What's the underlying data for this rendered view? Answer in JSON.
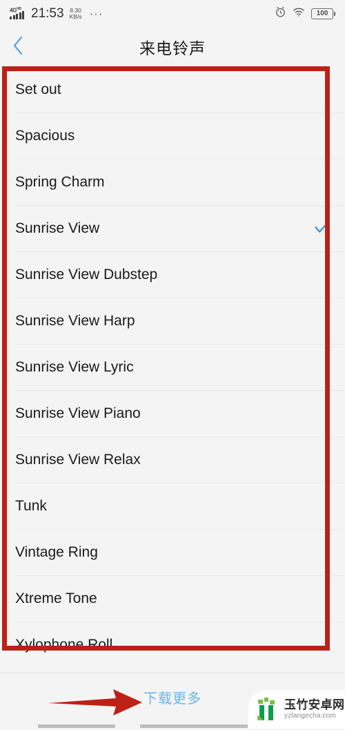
{
  "status_bar": {
    "network_type": "4G",
    "network_suffix": "HD",
    "time": "21:53",
    "net_speed_value": "8.30",
    "net_speed_unit": "KB/s",
    "overflow_dots": "···",
    "alarm_icon": "alarm-clock-icon",
    "wifi_icon": "wifi-icon",
    "battery_level": "100"
  },
  "header": {
    "back_icon": "chevron-left-icon",
    "title": "来电铃声"
  },
  "list": {
    "selected": "Sunrise View",
    "check_icon": "check-icon",
    "items": [
      {
        "name": "Set out",
        "selected": false
      },
      {
        "name": "Spacious",
        "selected": false
      },
      {
        "name": "Spring Charm",
        "selected": false
      },
      {
        "name": "Sunrise View",
        "selected": true
      },
      {
        "name": "Sunrise View Dubstep",
        "selected": false
      },
      {
        "name": "Sunrise View Harp",
        "selected": false
      },
      {
        "name": "Sunrise View Lyric",
        "selected": false
      },
      {
        "name": "Sunrise View Piano",
        "selected": false
      },
      {
        "name": "Sunrise View Relax",
        "selected": false
      },
      {
        "name": "Tunk",
        "selected": false
      },
      {
        "name": "Vintage Ring",
        "selected": false
      },
      {
        "name": "Xtreme Tone",
        "selected": false
      },
      {
        "name": "Xylophone Roll",
        "selected": false
      }
    ]
  },
  "footer": {
    "download_more_label": "下载更多"
  },
  "annotations": {
    "box_color": "#bd2116",
    "arrow_color": "#bd2116",
    "arrow_name": "red-pointer-arrow",
    "box_name": "red-highlight-box"
  },
  "watermark": {
    "site_name": "玉竹安卓网",
    "site_url": "yzlangecha.com"
  },
  "theme": {
    "accent_blue": "#6ab4e8",
    "check_blue": "#3d9bd8",
    "background": "#f4f4f4",
    "text_primary": "#1a1a1a"
  }
}
